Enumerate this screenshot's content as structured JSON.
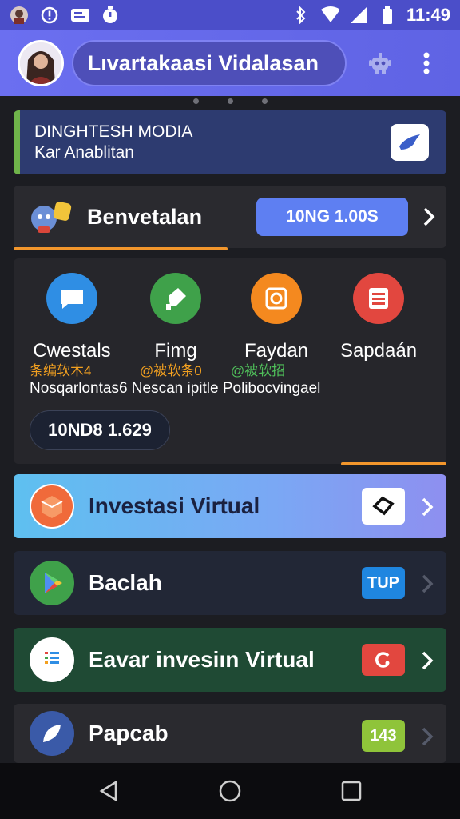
{
  "status": {
    "time": "11:49",
    "left_icons": [
      "avatar-icon",
      "alert-icon",
      "mail-icon",
      "clock-icon"
    ],
    "right_icons": [
      "bluetooth-icon",
      "wifi-icon",
      "signal-icon",
      "battery-icon"
    ]
  },
  "app": {
    "title": "Lıvartakaasi Vidalasan",
    "accent": "#6b6ff0"
  },
  "banner": {
    "line1": "DINGHTESH MODIA",
    "line2": "Kar Anablitan"
  },
  "section": {
    "title": "Benvetalan",
    "button": "10NG 1.00S"
  },
  "grid": {
    "items": [
      {
        "label": "Cwestals",
        "color": "#2f8ee4"
      },
      {
        "label": "Fimg",
        "color": "#3fa14a"
      },
      {
        "label": "Faydan",
        "color": "#f4891f"
      },
      {
        "label": "Sapdaán",
        "color": "#e2473f"
      }
    ],
    "sub_a": "条编软木4",
    "sub_b": "@被软条0",
    "sub_c": "@被软招",
    "caption": "Nosqarlontas6 Nescan ipitle Polibocvingael",
    "cta": "10ND8 1.629"
  },
  "rows": [
    {
      "label": "Investasi Virtual",
      "badge": "",
      "icon": "cube-icon"
    },
    {
      "label": "Baclah",
      "badge": "TUP",
      "icon": "play-store-icon"
    },
    {
      "label": "Eavar invesiın Virtual",
      "badge": "",
      "icon": "list-chat-icon"
    },
    {
      "label": "Papcab",
      "badge": "143",
      "icon": "leaf-icon"
    }
  ]
}
